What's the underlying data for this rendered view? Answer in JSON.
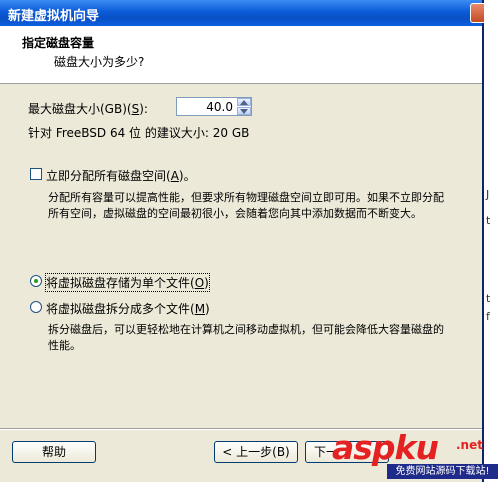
{
  "window": {
    "title": "新建虚拟机向导"
  },
  "header": {
    "title": "指定磁盘容量",
    "subtitle": "磁盘大小为多少?"
  },
  "disk": {
    "label_prefix": "最大磁盘大小(GB)(",
    "label_key": "S",
    "label_suffix": "):",
    "value": "40.0",
    "recommendation": "针对 FreeBSD 64 位 的建议大小: 20 GB"
  },
  "allocate": {
    "label_prefix": "立即分配所有磁盘空间(",
    "label_key": "A",
    "label_suffix": ")。",
    "checked": false,
    "desc_line1": "分配所有容量可以提高性能，但要求所有物理磁盘空间立即可用。如果不立即分配",
    "desc_line2": "所有空间，虚拟磁盘的空间最初很小，会随着您向其中添加数据而不断变大。"
  },
  "single_file": {
    "label_prefix": "将虚拟磁盘存储为单个文件(",
    "label_key": "O",
    "label_suffix": ")",
    "selected": true
  },
  "multi_file": {
    "label_prefix": "将虚拟磁盘拆分成多个文件(",
    "label_key": "M",
    "label_suffix": ")",
    "selected": false,
    "desc_line1": "拆分磁盘后，可以更轻松地在计算机之间移动虚拟机，但可能会降低大容量磁盘的",
    "desc_line2": "性能。"
  },
  "buttons": {
    "help": "帮助",
    "back": "< 上一步(B)",
    "next": "下一"
  },
  "watermark": {
    "main": "aspku",
    "net": ".net",
    "sub": "免费网站源码下载站!"
  },
  "colors": {
    "title_bar": "#0b5bd9",
    "dialog_bg": "#ece9d8",
    "watermark": "#e52222"
  }
}
